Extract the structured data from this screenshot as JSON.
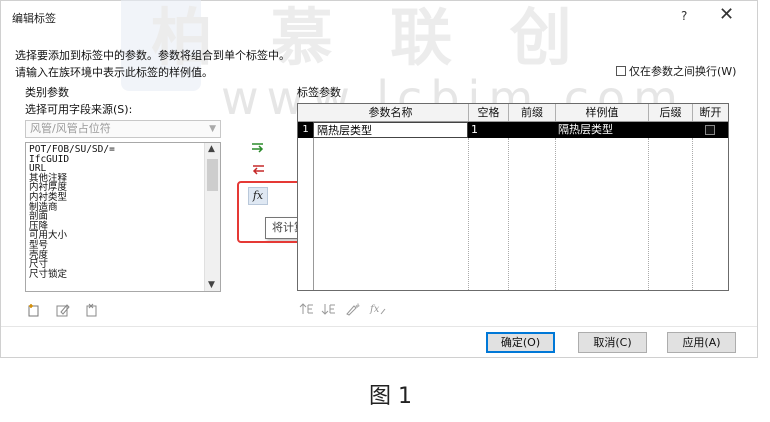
{
  "window": {
    "title": "编辑标签",
    "help": "?",
    "close": "✕"
  },
  "watermark": {
    "big_text": "柏 慕 联 创",
    "url": "www.lcbim.com"
  },
  "description": {
    "line1": "选择要添加到标签中的参数。参数将组合到单个标签中。",
    "line2": "请输入在族环境中表示此标签的样例值。"
  },
  "wrap_checkbox": {
    "label": "仅在参数之间换行(W)",
    "checked": false
  },
  "left_panel": {
    "category_label": "类别参数",
    "source_label": "选择可用字段来源(S):",
    "source_value": "风管/风管占位符",
    "params": [
      "POT/FOB/SU/SD/=",
      "IfcGUID",
      "URL",
      "其他注释",
      "内衬厚度",
      "内衬类型",
      "制造商",
      "剖面",
      "压降",
      "可用大小",
      "型号",
      "壳度",
      "尺寸",
      "尺寸锁定"
    ]
  },
  "middle": {
    "add_icon": "add-param-icon",
    "remove_icon": "remove-param-icon",
    "fx_label": "fx",
    "tooltip": "将计算的参数添加到标签"
  },
  "grid": {
    "title": "标签参数",
    "columns": [
      "参数名称",
      "空格",
      "前缀",
      "样例值",
      "后缀",
      "断开"
    ],
    "rows": [
      {
        "num": "1",
        "name": "隔热层类型",
        "space": "1",
        "prefix": "",
        "sample": "隔热层类型",
        "suffix": "",
        "break": false
      }
    ]
  },
  "bottom_tools_left": [
    "new-param-icon",
    "edit-param-icon",
    "delete-param-icon"
  ],
  "bottom_tools_right": [
    "move-up-icon",
    "move-down-icon",
    "edit-format-icon",
    "fx-edit-icon"
  ],
  "buttons": {
    "ok": "确定(O)",
    "cancel": "取消(C)",
    "apply": "应用(A)"
  },
  "caption": "图 1",
  "colors": {
    "highlight": "#e53935",
    "selected_row": "#000000",
    "accent": "#0078d7"
  }
}
